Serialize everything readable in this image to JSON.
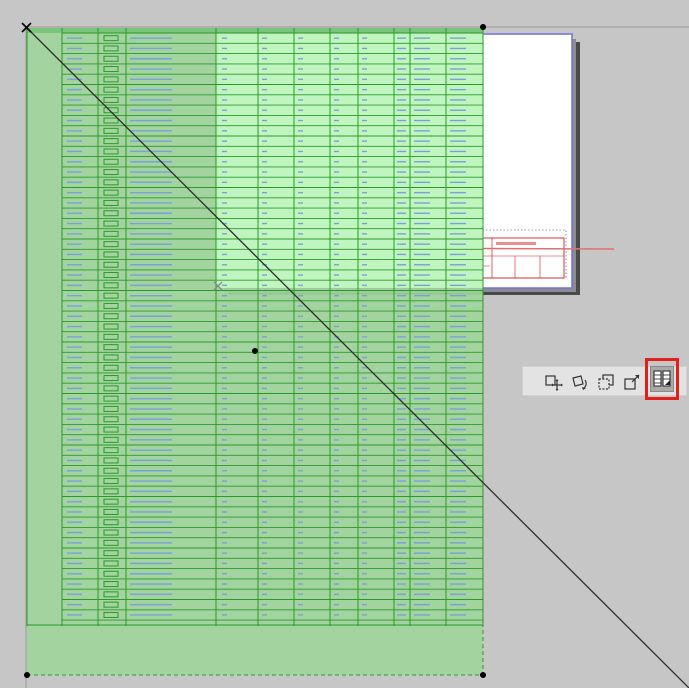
{
  "app": {
    "view": "floor-plan-canvas"
  },
  "selection": {
    "row_count": 57,
    "body_columns": 7,
    "has_cross_diagonal": true
  },
  "colors": {
    "background": "#c6c6c6",
    "selection_fill": "#9fd49a",
    "grid_line": "#2a9a2a",
    "highlight": "#c8ffc8",
    "title_block": "#cc2222",
    "sheet_border": "#7070e0",
    "palette_highlight": "#e0201a"
  },
  "pet_palette": {
    "items": [
      {
        "name": "drag-icon"
      },
      {
        "name": "rotate-icon"
      },
      {
        "name": "mirror-icon"
      },
      {
        "name": "resize-icon"
      },
      {
        "name": "split-table-icon",
        "active": true
      }
    ]
  }
}
